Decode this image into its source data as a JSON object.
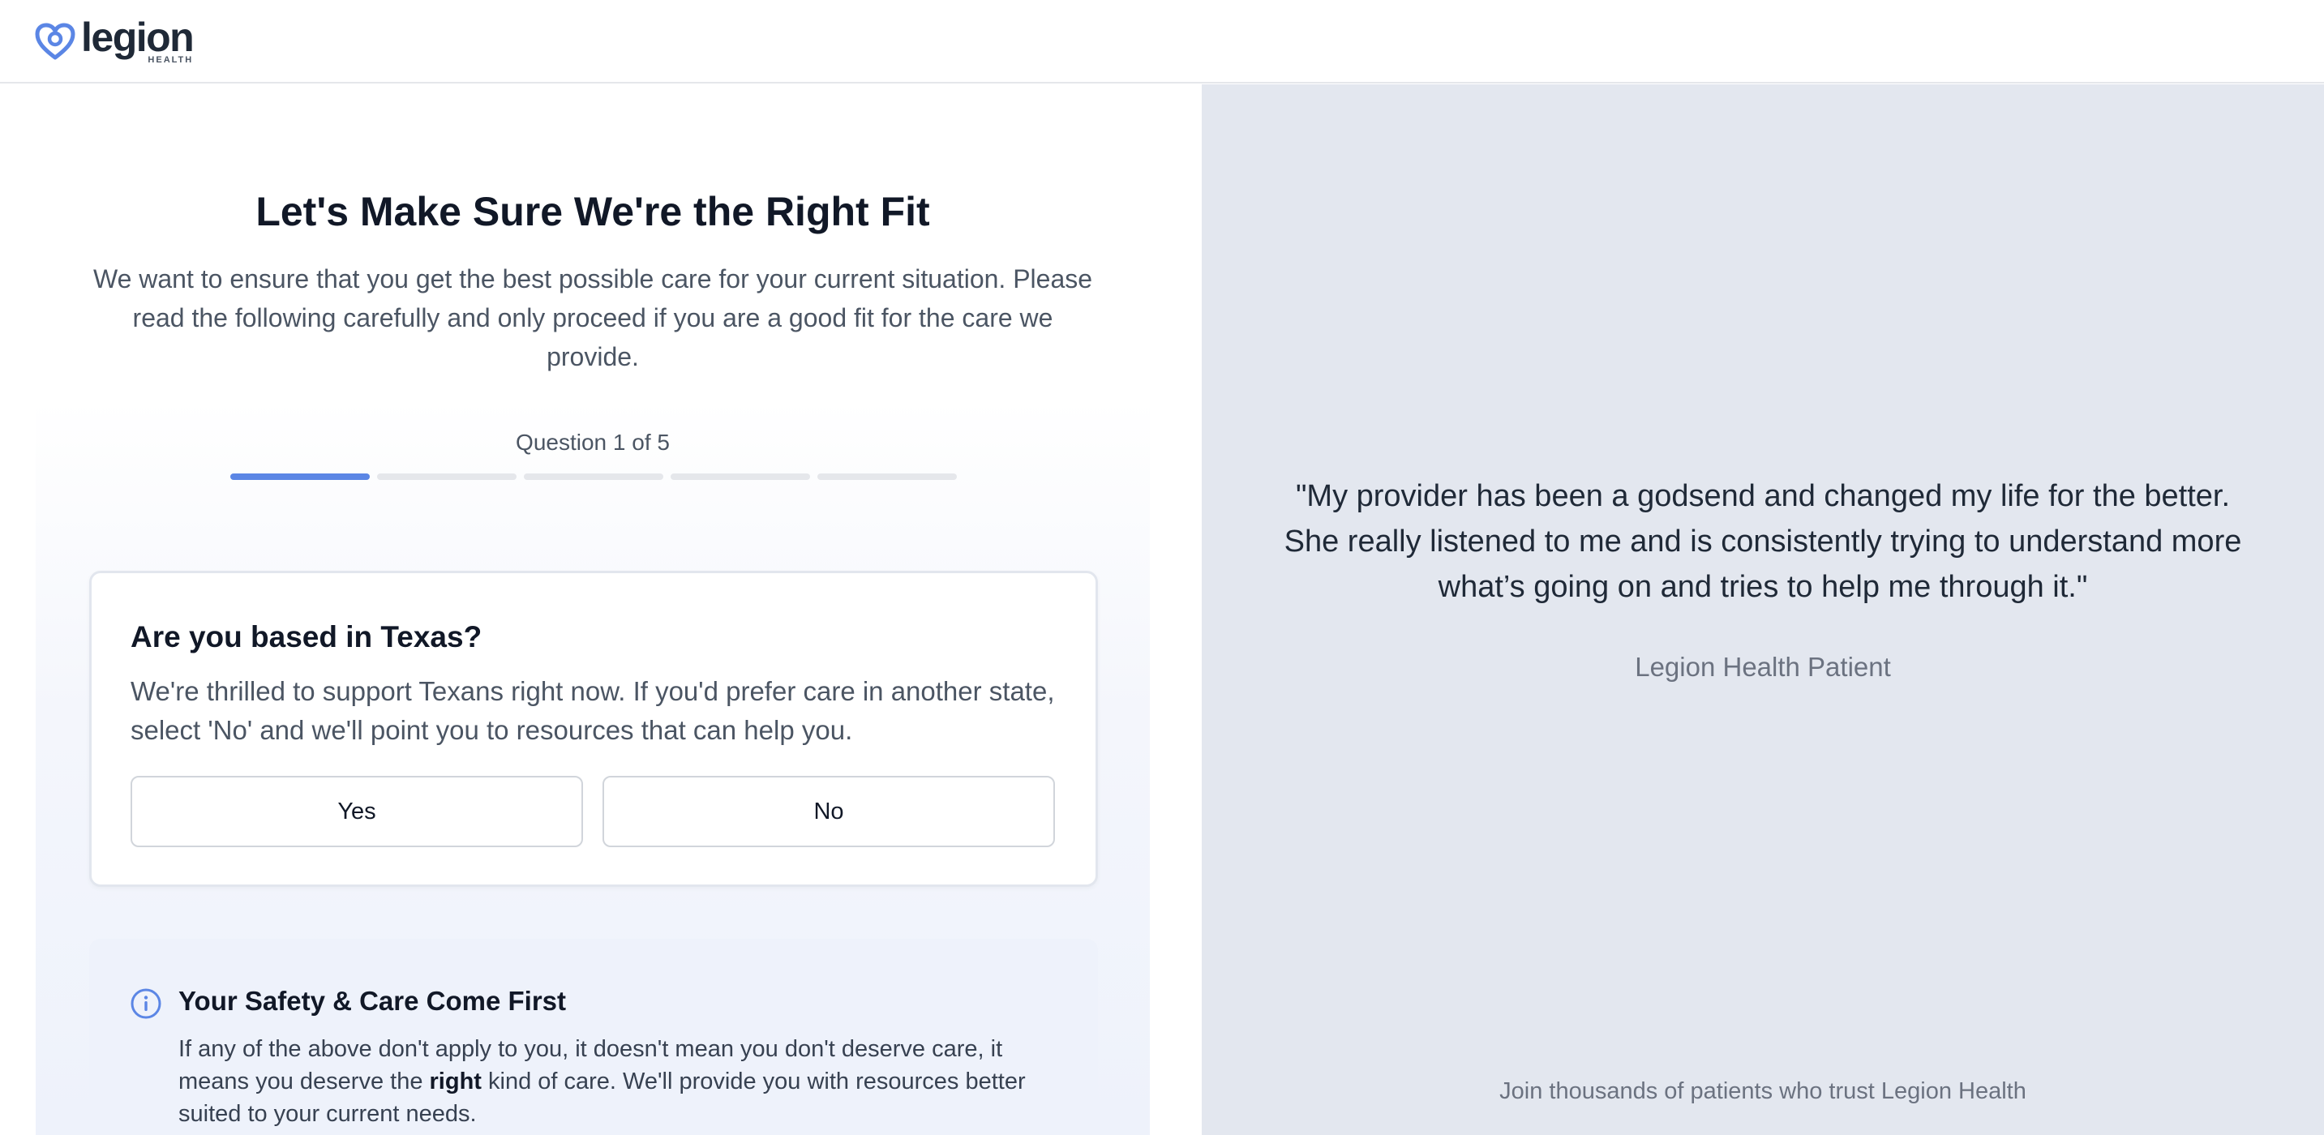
{
  "header": {
    "logo_word": "legion",
    "logo_sub": "HEALTH",
    "logo_icon": "heart-icon",
    "brand_color": "#5b86e5"
  },
  "intro": {
    "title": "Let's Make Sure We're the Right Fit",
    "subtitle": "We want to ensure that you get the best possible care for your current situation. Please read the following carefully and only proceed if you are a good fit for the care we provide."
  },
  "progress": {
    "label": "Question 1 of 5",
    "current": 1,
    "total": 5
  },
  "question": {
    "title": "Are you based in Texas?",
    "description": "We're thrilled to support Texans right now. If you'd prefer care in another state, select 'No' and we'll point you to resources that can help you.",
    "yes_label": "Yes",
    "no_label": "No"
  },
  "info": {
    "icon": "info-icon",
    "title": "Your Safety & Care Come First",
    "text_before": "If any of the above don't apply to you, it doesn't mean you don't deserve care, it means you deserve the ",
    "text_bold": "right",
    "text_after": " kind of care. We'll provide you with resources better suited to your current needs."
  },
  "testimonial": {
    "quote": "\"My provider has been a godsend and changed my life for the better. She really listened to me and is consistently trying to understand more what’s going on and tries to help me through it.\"",
    "attribution": "Legion Health Patient",
    "footer": "Join thousands of patients who trust Legion Health"
  }
}
